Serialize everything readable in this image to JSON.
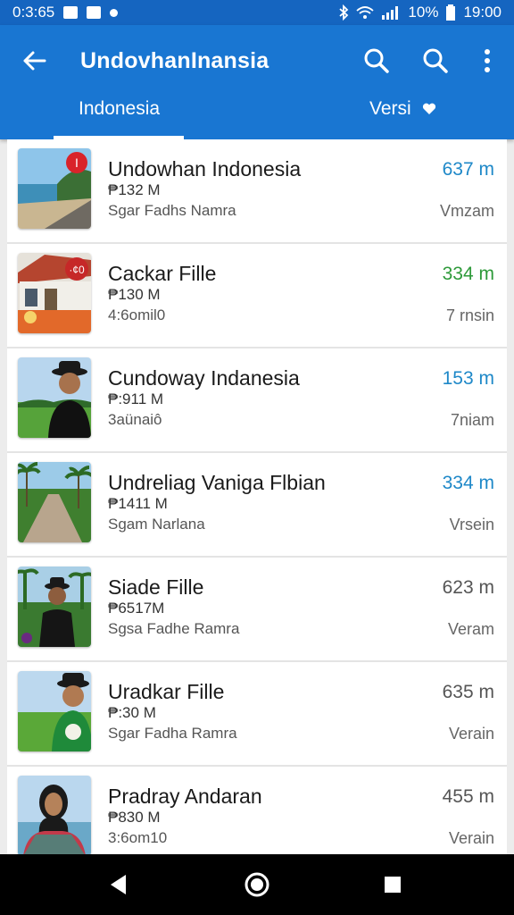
{
  "status_bar": {
    "time_left": "0:3:65",
    "battery": "10%",
    "clock": "19:00"
  },
  "app_bar": {
    "title": "UndovhanInansia",
    "colors": {
      "primary": "#1976d2",
      "status": "#1565c0"
    }
  },
  "tabs": [
    {
      "label": "Indonesia",
      "selected": true
    },
    {
      "label": "Versi",
      "selected": false,
      "icon": "heart-icon"
    }
  ],
  "items": [
    {
      "title": "Undowhan Indonesia",
      "price": "₱132 M",
      "subtitle": "Sgar Fadhs Namra",
      "distance": "637 m",
      "time": "Vmzam",
      "distance_color": "#1e88c8",
      "badge": "I",
      "image": "beach"
    },
    {
      "title": "Cackar Fille",
      "price": "₱130 M",
      "subtitle": "4:6omil0",
      "distance": "334 m",
      "time": "7 rnsin",
      "distance_color": "#2e9a3a",
      "badge": "·¢0",
      "image": "house"
    },
    {
      "title": "Cundoway Indanesia",
      "price": "₱:911 M",
      "subtitle": "3aünaiô",
      "distance": "153 m",
      "time": "7niam",
      "distance_color": "#1e88c8",
      "image": "person-black"
    },
    {
      "title": "Undreliag Vaniga Flbian",
      "price": "₱1411 M",
      "subtitle": "Sgam Narlana",
      "distance": "334 m",
      "time": "Vrsein",
      "distance_color": "#1e88c8",
      "image": "road"
    },
    {
      "title": "Siade Fille",
      "price": "₱6517M",
      "subtitle": "Sgsa Fadhe Ramra",
      "distance": "623 m",
      "time": "Veram",
      "distance_color": "#555555",
      "image": "person-palms"
    },
    {
      "title": "Uradkar Fille",
      "price": "₱:30 M",
      "subtitle": "Sgar Fadha Ramra",
      "distance": "635 m",
      "time": "Verain",
      "distance_color": "#555555",
      "image": "person-green"
    },
    {
      "title": "Pradray Andaran",
      "price": "₱830 M",
      "subtitle": "3:6om10",
      "distance": "455 m",
      "time": "Verain",
      "distance_color": "#555555",
      "image": "woman-hijab"
    }
  ]
}
